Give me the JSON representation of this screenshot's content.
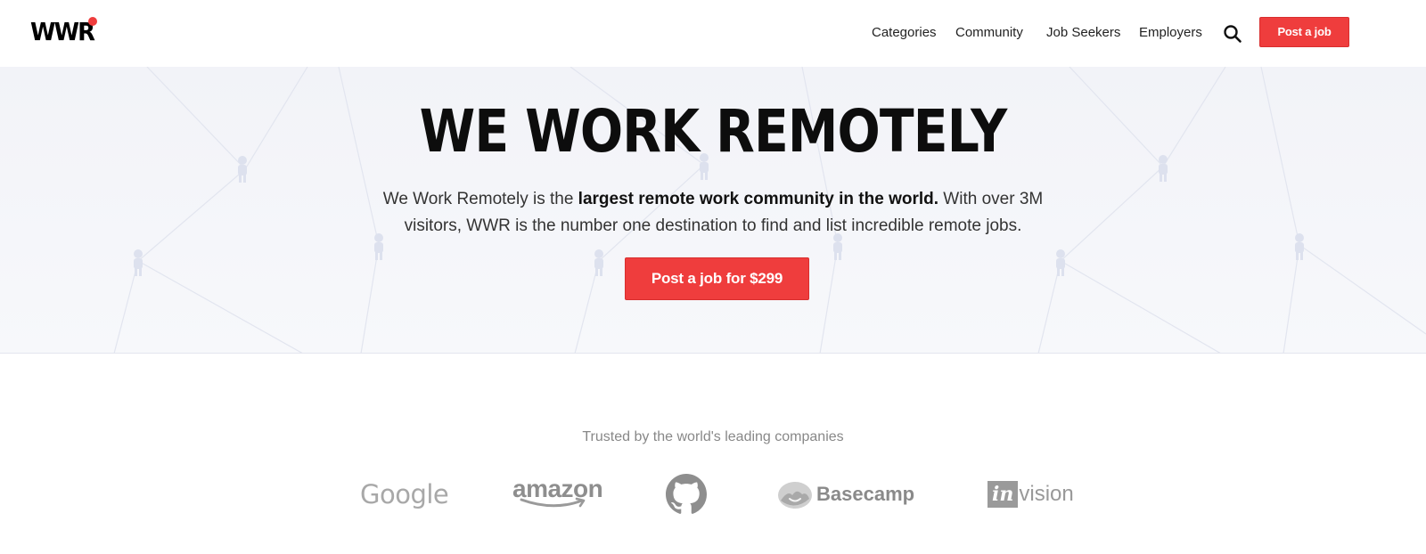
{
  "header": {
    "logo_text": "WWR",
    "nav": [
      {
        "label": "Categories"
      },
      {
        "label": "Community"
      },
      {
        "label": "Job Seekers"
      },
      {
        "label": "Employers"
      }
    ],
    "search_icon": "search-icon",
    "post_button_label": "Post a job"
  },
  "hero": {
    "title": "WE WORK REMOTELY",
    "desc_pre": "We Work Remotely is the ",
    "desc_bold": "largest remote work community in the world.",
    "desc_post": " With over 3M visitors, WWR is the number one destination to find and list incredible remote jobs.",
    "cta_label": "Post a job for $299"
  },
  "trusted": {
    "heading": "Trusted by the world's leading companies",
    "companies": [
      {
        "name": "Google",
        "text": "Google"
      },
      {
        "name": "Amazon",
        "text": "amazon"
      },
      {
        "name": "GitHub",
        "icon": "github-icon"
      },
      {
        "name": "Basecamp",
        "text": "Basecamp"
      },
      {
        "name": "InVision",
        "text_box": "in",
        "text": "vision"
      }
    ]
  },
  "colors": {
    "accent": "#ef3d3d",
    "hero_bg": "#f4f5f9"
  }
}
